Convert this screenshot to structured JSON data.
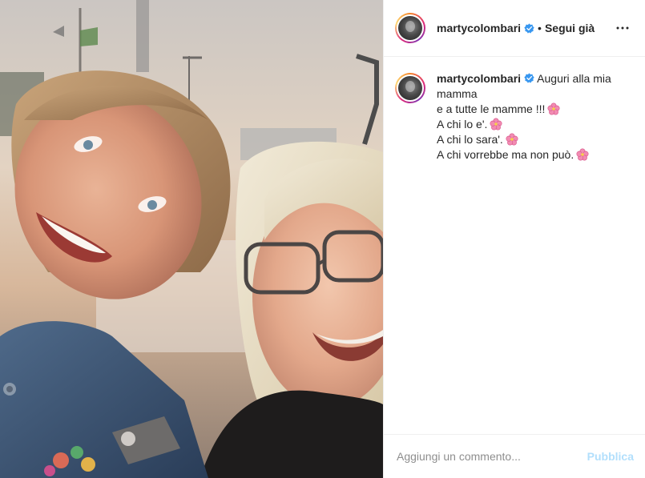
{
  "post": {
    "author": {
      "username": "martycolombari",
      "verified": true,
      "follow_separator": "•",
      "follow_status": "Segui già"
    },
    "more_icon": "more-horizontal-icon",
    "caption": {
      "username": "martycolombari",
      "lines": [
        "Auguri alla mia",
        "mamma",
        "e a tutte le mamme !!!",
        "A chi lo e'.",
        "A chi lo sara'.",
        "A chi vorrebbe ma non può."
      ],
      "emoji_icon": "hibiscus-icon"
    },
    "comment_box": {
      "placeholder": "Aggiungi un commento...",
      "submit_label": "Pubblica"
    },
    "colors": {
      "accent_disabled": "#b2dffc",
      "verified_blue": "#3897f0",
      "text": "#262626",
      "muted": "#8e8e8e"
    }
  }
}
